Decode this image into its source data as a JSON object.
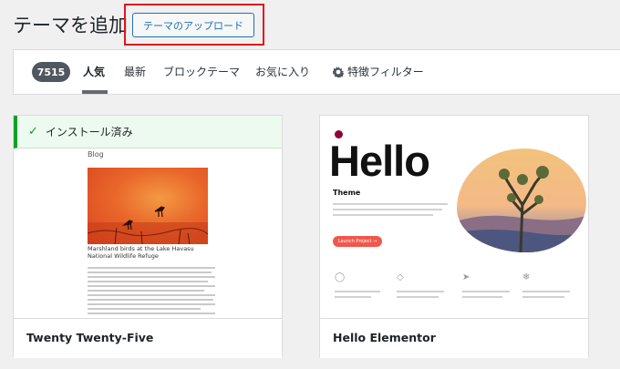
{
  "header": {
    "title": "テーマを追加",
    "upload_button": "テーマのアップロード"
  },
  "filter_bar": {
    "count": "7515",
    "tabs": [
      {
        "label": "人気",
        "current": true
      },
      {
        "label": "最新",
        "current": false
      },
      {
        "label": "ブロックテーマ",
        "current": false
      },
      {
        "label": "お気に入り",
        "current": false
      },
      {
        "label": "特徴フィルター",
        "current": false,
        "icon": "gear-icon"
      }
    ]
  },
  "themes": [
    {
      "name": "Twenty Twenty-Five",
      "installed_notice": "インストール済み",
      "preview": {
        "blog_label": "Blog",
        "caption": "Marshland birds at the Lake Havasu National Wildlife Refuge"
      }
    },
    {
      "name": "Hello Elementor",
      "preview": {
        "title": "Hello",
        "subtitle": "Theme",
        "button": "Launch Project →"
      }
    }
  ],
  "colors": {
    "accent": "#2271b1",
    "highlight": "#e0161b",
    "installed_green": "#00a32a",
    "hello_brand": "#92003b"
  }
}
